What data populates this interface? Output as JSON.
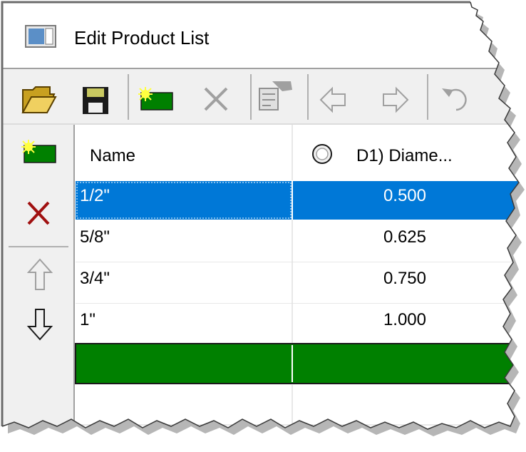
{
  "window": {
    "title": "Edit Product List",
    "icon": "window-app-icon"
  },
  "toolbar": {
    "buttons": [
      {
        "name": "open-folder",
        "icon": "open-folder-icon",
        "enabled": true
      },
      {
        "name": "save",
        "icon": "floppy-disk-icon",
        "enabled": true
      },
      {
        "name": "new-row",
        "icon": "new-row-icon",
        "enabled": true
      },
      {
        "name": "delete",
        "icon": "delete-x-icon",
        "enabled": false
      },
      {
        "name": "properties",
        "icon": "properties-icon",
        "enabled": false
      },
      {
        "name": "back",
        "icon": "arrow-left-icon",
        "enabled": false
      },
      {
        "name": "forward",
        "icon": "arrow-right-icon",
        "enabled": false
      },
      {
        "name": "undo",
        "icon": "undo-icon",
        "enabled": false
      }
    ]
  },
  "side_toolbar": {
    "buttons": [
      {
        "name": "add-row",
        "icon": "new-row-icon",
        "enabled": true
      },
      {
        "name": "remove-row",
        "icon": "red-x-icon",
        "enabled": true
      },
      {
        "name": "move-up",
        "icon": "arrow-up-icon",
        "enabled": false
      },
      {
        "name": "move-down",
        "icon": "arrow-down-icon",
        "enabled": true
      }
    ]
  },
  "grid": {
    "columns": [
      {
        "label": "Name"
      },
      {
        "label": "D1) Diame...",
        "icon": "circle-diameter-icon"
      }
    ],
    "rows": [
      {
        "name": "1/2\"",
        "diameter": "0.500",
        "selected": true
      },
      {
        "name": "5/8\"",
        "diameter": "0.625",
        "selected": false
      },
      {
        "name": "3/4\"",
        "diameter": "0.750",
        "selected": false
      },
      {
        "name": "1\"",
        "diameter": "1.000",
        "selected": false
      }
    ],
    "new_row_color": "#008000"
  },
  "colors": {
    "selection": "#0078d7",
    "new_row": "#008000",
    "toolbar_bg": "#f0f0f0"
  }
}
